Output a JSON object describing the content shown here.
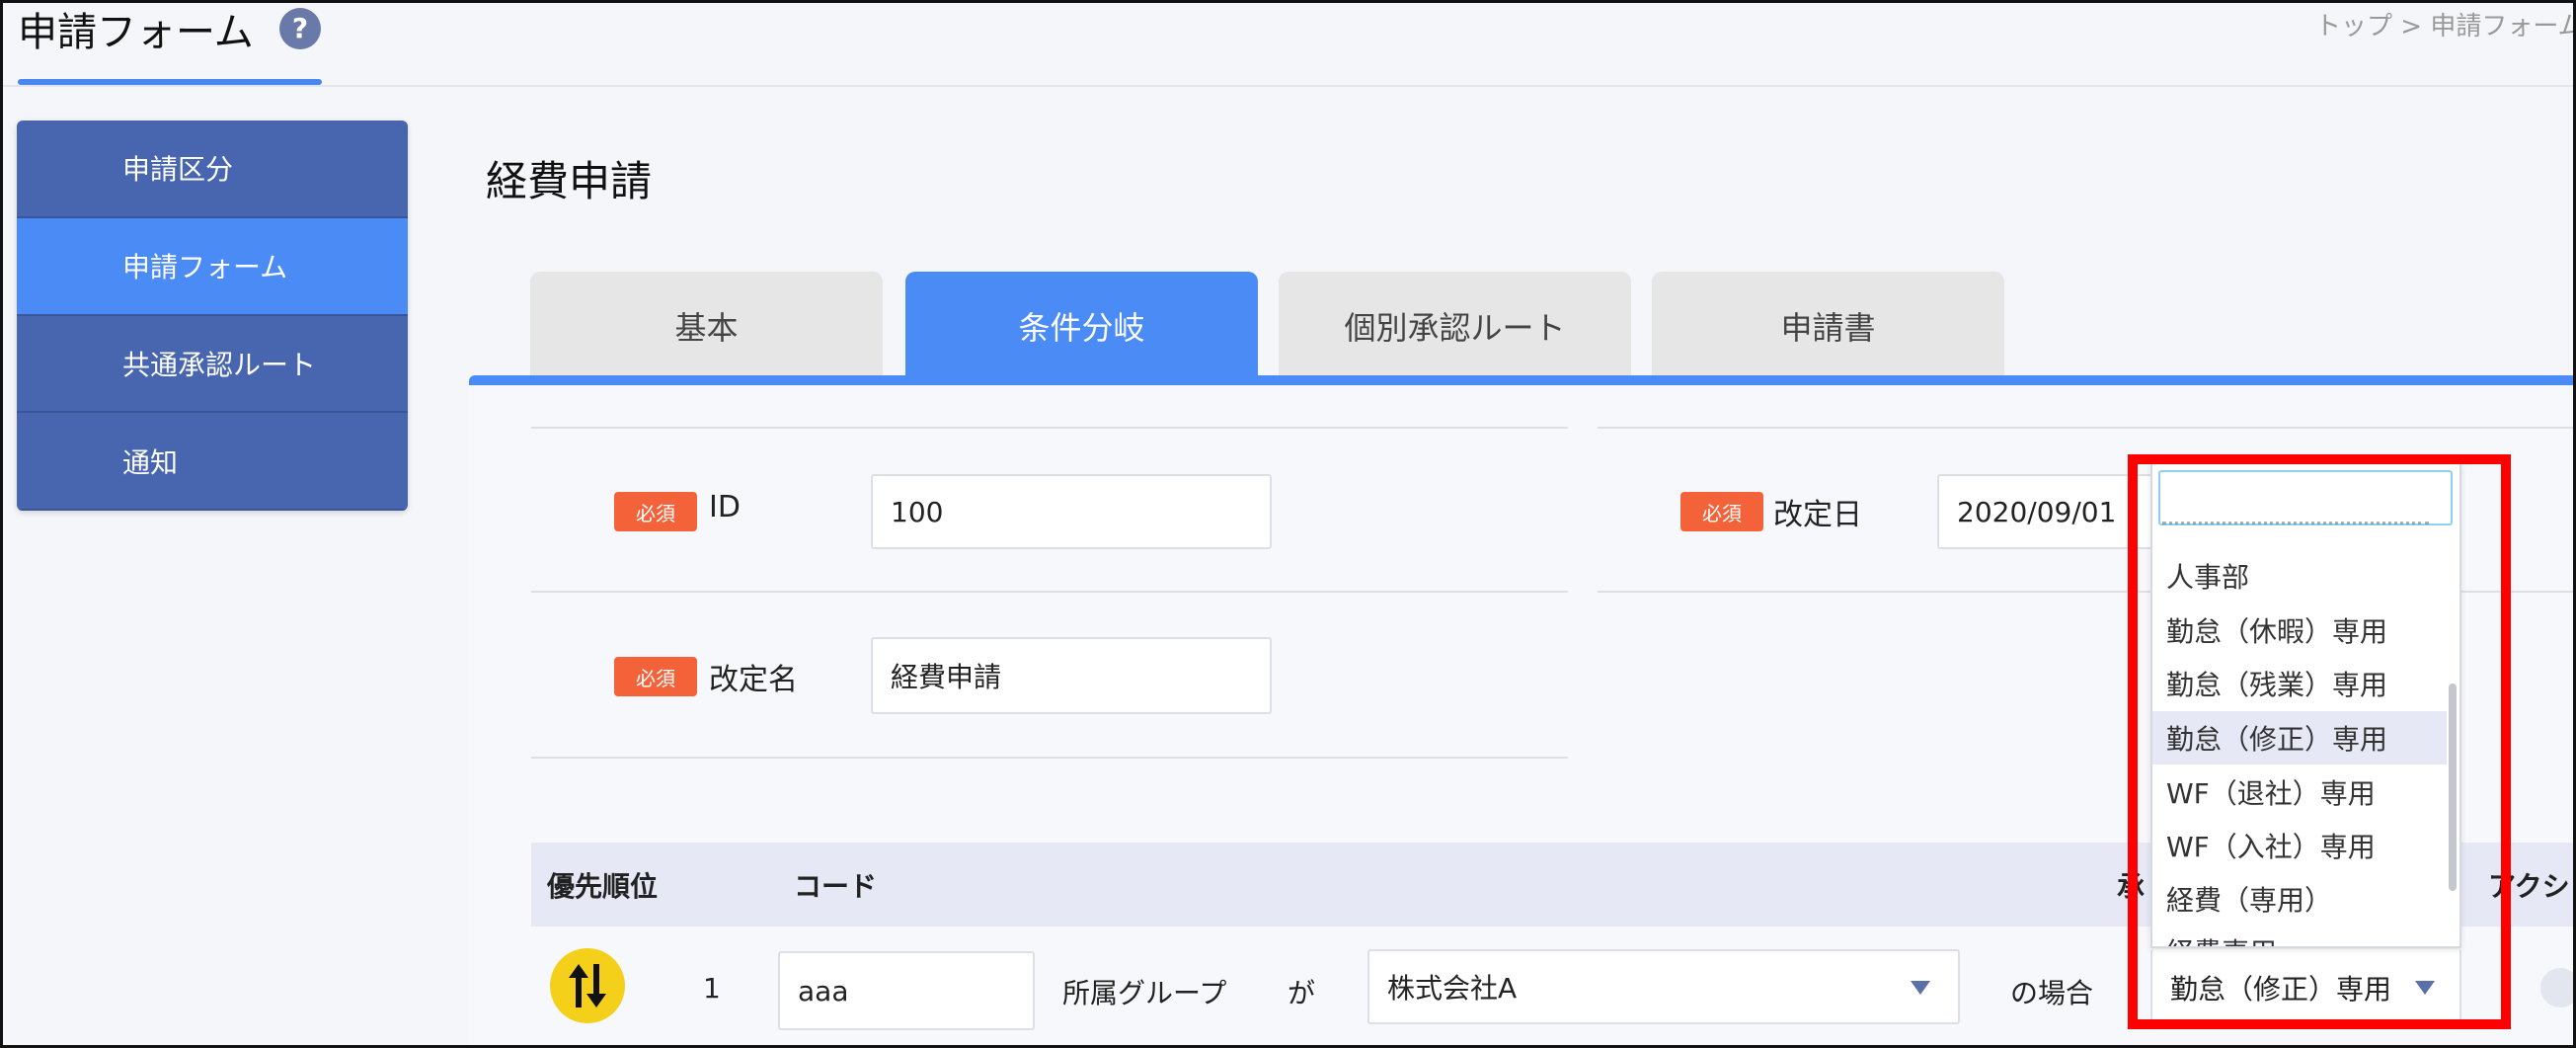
{
  "header": {
    "title": "申請フォーム",
    "help_icon": "?",
    "breadcrumb": "トップ  >  申請フォーム"
  },
  "sidebar": {
    "items": [
      {
        "label": "申請区分"
      },
      {
        "label": "申請フォーム",
        "active": true
      },
      {
        "label": "共通承認ルート"
      },
      {
        "label": "通知"
      }
    ]
  },
  "main": {
    "title": "経費申請",
    "tabs": [
      {
        "label": "基本"
      },
      {
        "label": "条件分岐",
        "active": true
      },
      {
        "label": "個別承認ルート"
      },
      {
        "label": "申請書"
      }
    ]
  },
  "form": {
    "required_badge": "必須",
    "id_label": "ID",
    "id_value": "100",
    "revision_name_label": "改定名",
    "revision_name_value": "経費申請",
    "revision_date_label": "改定日",
    "revision_date_value": "2020/09/01"
  },
  "table": {
    "headers": {
      "priority": "優先順位",
      "code": "コード",
      "approve_partial": "承",
      "action_partial": "アクシ"
    },
    "rows": [
      {
        "priority": "1",
        "code": "aaa",
        "condition_field": "所属グループ",
        "ga": "が",
        "condition_value": "株式会社A",
        "case_text": "の場合",
        "route_value": "勤怠（修正）専用"
      }
    ]
  },
  "dropdown": {
    "search_value": "",
    "items": [
      {
        "label": "人事部"
      },
      {
        "label": "勤怠（休暇）専用"
      },
      {
        "label": "勤怠（残業）専用"
      },
      {
        "label": "勤怠（修正）専用",
        "highlighted": true
      },
      {
        "label": "WF（退社）専用"
      },
      {
        "label": "WF（入社）専用"
      },
      {
        "label": "経費（専用）"
      },
      {
        "label": "経費専用"
      }
    ]
  },
  "colors": {
    "accent": "#4b8bf5",
    "sidebar": "#4866b0",
    "required": "#f4623a",
    "highlight_box": "#ff0000"
  }
}
